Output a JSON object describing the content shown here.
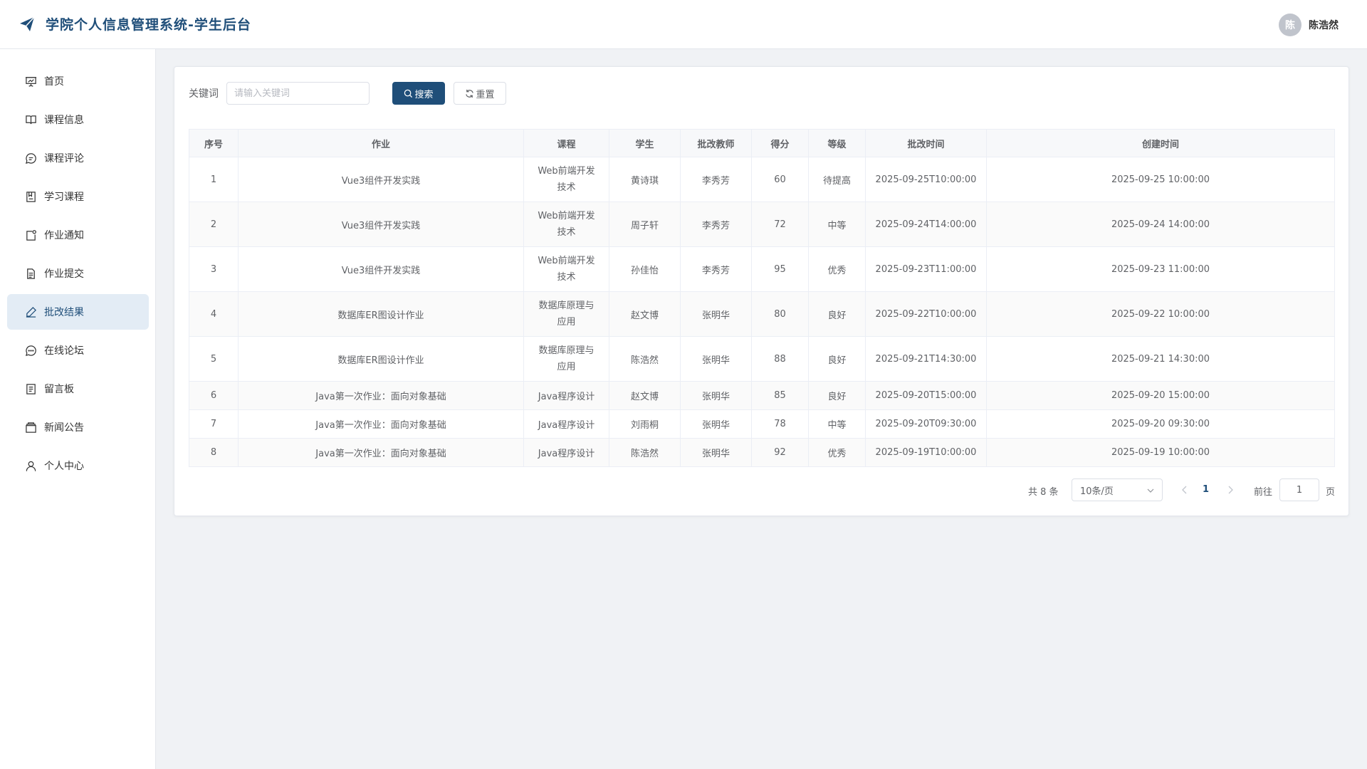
{
  "header": {
    "title": "学院个人信息管理系统-学生后台",
    "user_initial": "陈",
    "user_name": "陈浩然",
    "brand_color": "#1f4e79"
  },
  "sidebar": {
    "items": [
      {
        "label": "首页",
        "icon": "presentation-icon"
      },
      {
        "label": "课程信息",
        "icon": "book-open-icon"
      },
      {
        "label": "课程评论",
        "icon": "comment-icon"
      },
      {
        "label": "学习课程",
        "icon": "notebook-icon"
      },
      {
        "label": "作业通知",
        "icon": "notice-icon"
      },
      {
        "label": "作业提交",
        "icon": "document-icon"
      },
      {
        "label": "批改结果",
        "icon": "edit-pen-icon",
        "active": true
      },
      {
        "label": "在线论坛",
        "icon": "chat-dots-icon"
      },
      {
        "label": "留言板",
        "icon": "tickets-icon"
      },
      {
        "label": "新闻公告",
        "icon": "news-box-icon"
      },
      {
        "label": "个人中心",
        "icon": "user-icon"
      }
    ]
  },
  "search": {
    "label": "关键词",
    "placeholder": "请输入关键词",
    "value": "",
    "search_label": "搜索",
    "reset_label": "重置"
  },
  "table": {
    "headers": [
      "序号",
      "作业",
      "课程",
      "学生",
      "批改教师",
      "得分",
      "等级",
      "批改时间",
      "创建时间"
    ],
    "rows": [
      {
        "no": "1",
        "assignment": "Vue3组件开发实践",
        "course_l1": "Web前端开发",
        "course_l2": "技术",
        "student": "黄诗琪",
        "teacher": "李秀芳",
        "score": "60",
        "grade": "待提高",
        "graded_at": "2025-09-25T10:00:00",
        "created_at": "2025-09-25 10:00:00"
      },
      {
        "no": "2",
        "assignment": "Vue3组件开发实践",
        "course_l1": "Web前端开发",
        "course_l2": "技术",
        "student": "周子轩",
        "teacher": "李秀芳",
        "score": "72",
        "grade": "中等",
        "graded_at": "2025-09-24T14:00:00",
        "created_at": "2025-09-24 14:00:00"
      },
      {
        "no": "3",
        "assignment": "Vue3组件开发实践",
        "course_l1": "Web前端开发",
        "course_l2": "技术",
        "student": "孙佳怡",
        "teacher": "李秀芳",
        "score": "95",
        "grade": "优秀",
        "graded_at": "2025-09-23T11:00:00",
        "created_at": "2025-09-23 11:00:00"
      },
      {
        "no": "4",
        "assignment": "数据库ER图设计作业",
        "course_l1": "数据库原理与",
        "course_l2": "应用",
        "student": "赵文博",
        "teacher": "张明华",
        "score": "80",
        "grade": "良好",
        "graded_at": "2025-09-22T10:00:00",
        "created_at": "2025-09-22 10:00:00"
      },
      {
        "no": "5",
        "assignment": "数据库ER图设计作业",
        "course_l1": "数据库原理与",
        "course_l2": "应用",
        "student": "陈浩然",
        "teacher": "张明华",
        "score": "88",
        "grade": "良好",
        "graded_at": "2025-09-21T14:30:00",
        "created_at": "2025-09-21 14:30:00"
      },
      {
        "no": "6",
        "assignment": "Java第一次作业：面向对象基础",
        "course_l1": "Java程序设计",
        "course_l2": "",
        "student": "赵文博",
        "teacher": "张明华",
        "score": "85",
        "grade": "良好",
        "graded_at": "2025-09-20T15:00:00",
        "created_at": "2025-09-20 15:00:00"
      },
      {
        "no": "7",
        "assignment": "Java第一次作业：面向对象基础",
        "course_l1": "Java程序设计",
        "course_l2": "",
        "student": "刘雨桐",
        "teacher": "张明华",
        "score": "78",
        "grade": "中等",
        "graded_at": "2025-09-20T09:30:00",
        "created_at": "2025-09-20 09:30:00"
      },
      {
        "no": "8",
        "assignment": "Java第一次作业：面向对象基础",
        "course_l1": "Java程序设计",
        "course_l2": "",
        "student": "陈浩然",
        "teacher": "张明华",
        "score": "92",
        "grade": "优秀",
        "graded_at": "2025-09-19T10:00:00",
        "created_at": "2025-09-19 10:00:00"
      }
    ]
  },
  "pagination": {
    "total_text": "共 8 条",
    "page_size": "10条/页",
    "current_page": "1",
    "goto_label": "前往",
    "goto_value": "1",
    "page_suffix": "页"
  }
}
